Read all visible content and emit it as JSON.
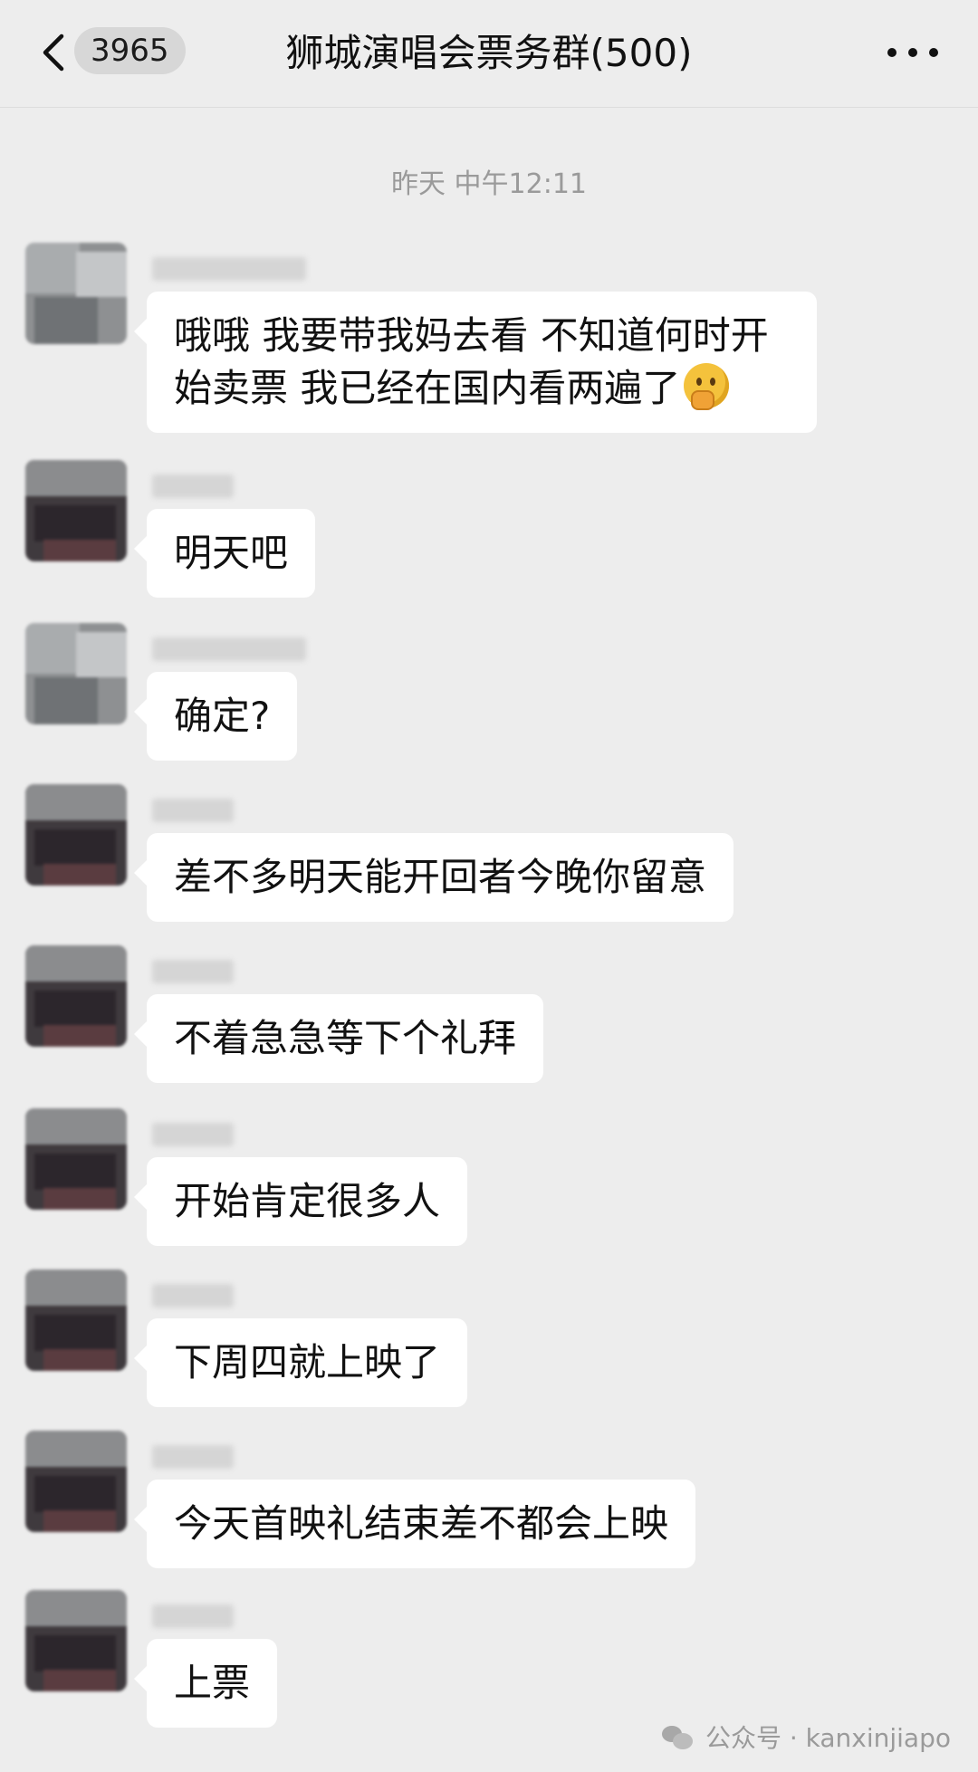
{
  "header": {
    "unread_count": "3965",
    "title": "狮城演唱会票务群(500)"
  },
  "timestamp": "昨天 中午12:11",
  "messages": [
    {
      "text": "哦哦 我要带我妈去看 不知道何时开始卖票 我已经在国内看两遍了",
      "emoji": "thinking-face"
    },
    {
      "text": "明天吧"
    },
    {
      "text": "确定?"
    },
    {
      "text": "差不多明天能开回者今晚你留意"
    },
    {
      "text": "不着急急等下个礼拜"
    },
    {
      "text": "开始肯定很多人"
    },
    {
      "text": "下周四就上映了"
    },
    {
      "text": "今天首映礼结束差不都会上映"
    },
    {
      "text": "上票"
    }
  ],
  "watermark": {
    "text": "公众号 · kanxinjiapo"
  },
  "colors": {
    "background": "#ededed",
    "bubble": "#ffffff",
    "timestamp": "#9a9a9a"
  }
}
